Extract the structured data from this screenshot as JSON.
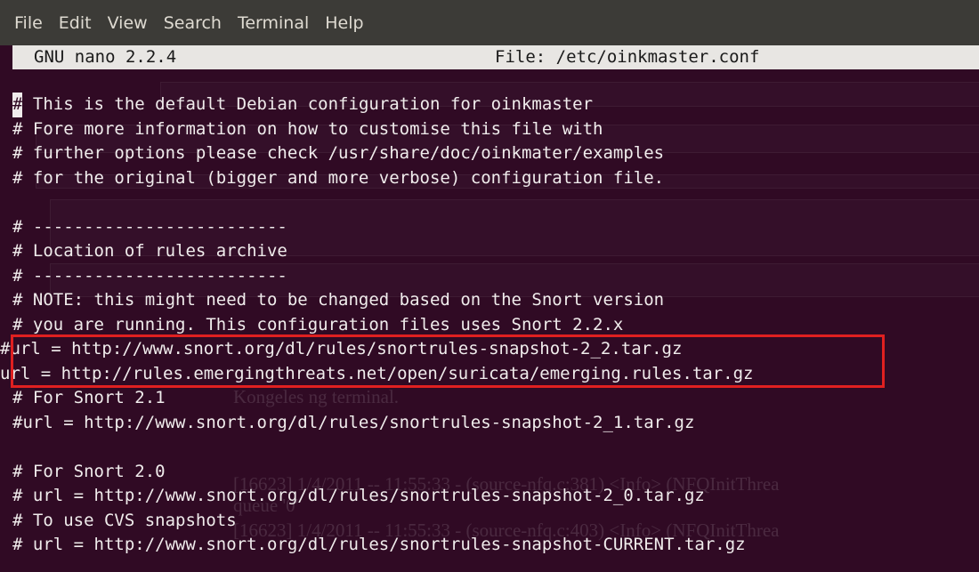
{
  "menubar": {
    "items": [
      "File",
      "Edit",
      "View",
      "Search",
      "Terminal",
      "Help"
    ]
  },
  "nano": {
    "version": "GNU nano 2.2.4",
    "file": "File: /etc/oinkmaster.conf"
  },
  "editor": {
    "cursor_char": "#",
    "first_line_rest": " This is the default Debian configuration for oinkmaster",
    "lines": [
      "# Fore more information on how to customise this file with",
      "# further options please check /usr/share/doc/oinkmater/examples",
      "# for the original (bigger and more verbose) configuration file.",
      "",
      "# -------------------------",
      "# Location of rules archive",
      "# -------------------------",
      "# NOTE: this might need to be changed based on the Snort version",
      "# you are running. This configuration files uses Snort 2.2.x",
      "#url = http://www.snort.org/dl/rules/snortrules-snapshot-2_2.tar.gz",
      "url = http://rules.emergingthreats.net/open/suricata/emerging.rules.tar.gz",
      "# For Snort 2.1",
      "#url = http://www.snort.org/dl/rules/snortrules-snapshot-2_1.tar.gz",
      "",
      "# For Snort 2.0",
      "# url = http://www.snort.org/dl/rules/snortrules-snapshot-2_0.tar.gz",
      "# To use CVS snapshots",
      "# url = http://www.snort.org/dl/rules/snortrules-snapshot-CURRENT.tar.gz"
    ]
  },
  "background_ghost": {
    "lines": [
      "Kongeles ng terminal.",
      "[16623] 1/4/2011 -- 11:55:33 - (source-nfq.c:381) <Info> (NFQInitThrea",
      "queue '0'",
      "[16623] 1/4/2011 -- 11:55:33 - (source-nfq.c:403) <Info> (NFQInitThrea"
    ]
  },
  "colors": {
    "terminal_bg": "#300a24",
    "menubar_bg": "#3c3b37",
    "highlight_border": "#e02020"
  }
}
